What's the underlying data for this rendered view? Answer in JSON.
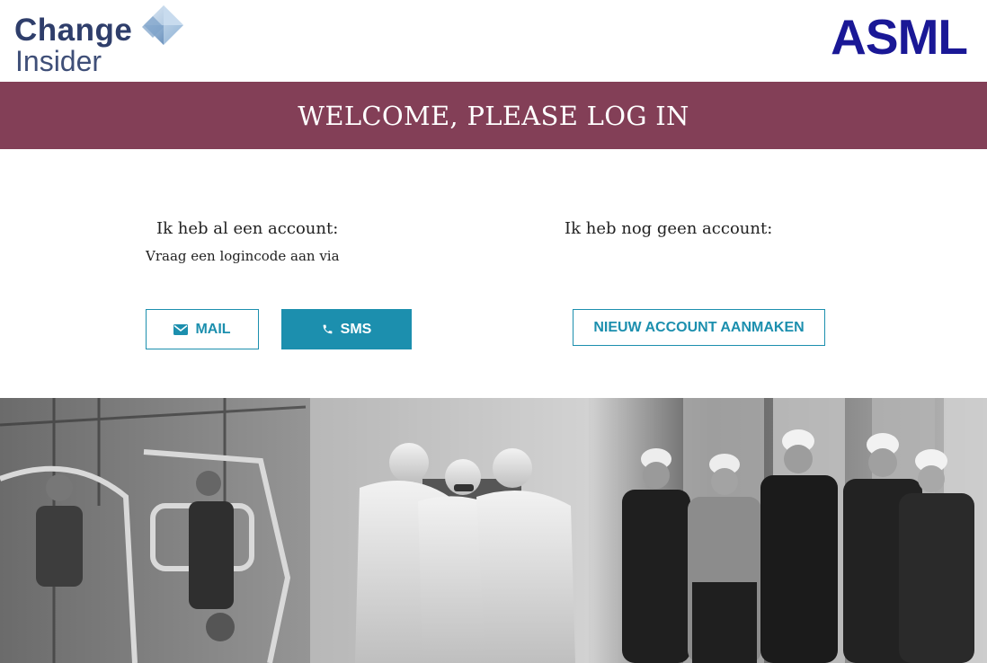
{
  "header": {
    "logo_left_line1": "Change",
    "logo_left_line2": "Insider",
    "logo_right": "ASML"
  },
  "banner": {
    "title": "WELCOME, PLEASE LOG IN"
  },
  "login": {
    "existing_title": "Ik heb al een account:",
    "existing_subtitle": "Vraag een logincode aan via",
    "mail_label": "MAIL",
    "sms_label": "SMS",
    "new_title": "Ik heb nog geen account:",
    "new_account_label": "NIEUW ACCOUNT AANMAKEN"
  },
  "colors": {
    "banner": "#833f57",
    "accent": "#1c8fae",
    "asml_blue": "#1a1896",
    "change_navy": "#2f3e6b"
  },
  "icons": [
    "envelope-icon",
    "phone-icon"
  ]
}
